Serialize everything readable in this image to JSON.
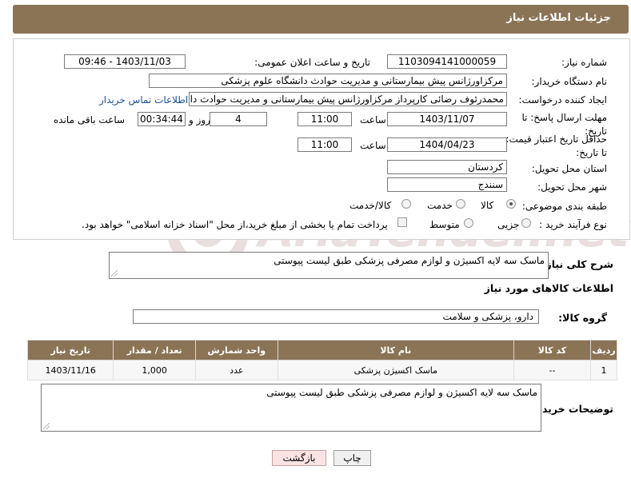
{
  "header": {
    "title": "جزئیات اطلاعات نیاز"
  },
  "form": {
    "need_number_label": "شماره نیاز:",
    "need_number": "1103094141000059",
    "announce_datetime_label": "تاریخ و ساعت اعلان عمومی:",
    "announce_datetime": "1403/11/03 - 09:46",
    "buyer_org_label": "نام دستگاه خریدار:",
    "buyer_org": "مرکزاورژانس پیش بیمارستانی و مدیریت حوادث دانشگاه علوم پزشکی",
    "requester_label": "ایجاد کننده درخواست:",
    "requester": "محمدرئوف رضائی کارپرداز مرکزاورژانس پیش بیمارستانی و مدیریت حوادث دانشگ",
    "contact_link": "اطلاعات تماس خریدار",
    "reply_deadline_label": "مهلت ارسال پاسخ: تا تاریخ:",
    "reply_date": "1403/11/07",
    "time_label": "ساعت",
    "reply_time": "11:00",
    "days_value": "4",
    "days_and_label": "روز و",
    "remaining_time": "00:34:44",
    "remaining_label": "ساعت باقی مانده",
    "price_validity_label": "حداقل تاریخ اعتبار قیمت: تا تاریخ:",
    "price_date": "1404/04/23",
    "price_time": "11:00",
    "province_label": "استان محل تحویل:",
    "province": "کردستان",
    "city_label": "شهر محل تحویل:",
    "city": "سنندج",
    "category_label": "طبقه بندی موضوعی:",
    "category_options": [
      "کالا",
      "خدمت",
      "کالا/خدمت"
    ],
    "category_selected": "کالا",
    "purchase_type_label": "نوع فرآیند خرید :",
    "purchase_options": [
      "جزیی",
      "متوسط"
    ],
    "payment_note": "پرداخت تمام یا بخشی از مبلغ خرید،از محل \"اسناد خزانه اسلامی\" خواهد بود."
  },
  "summary": {
    "label": "شرح کلی نیاز:",
    "text": "ماسک سه لایه اکسیژن و لوازم مصرفی پزشکی طبق لیست پیوستی"
  },
  "goods": {
    "section_title": "اطلاعات کالاهای مورد نیاز",
    "group_label": "گروه کالا:",
    "group_value": "دارو، پزشکی و سلامت",
    "columns": [
      "ردیف",
      "کد کالا",
      "نام کالا",
      "واحد شمارش",
      "تعداد / مقدار",
      "تاریخ نیاز"
    ],
    "rows": [
      {
        "row": "1",
        "code": "--",
        "name": "ماسک اکسیژن پزشکی",
        "unit": "عدد",
        "qty": "1,000",
        "date": "1403/11/16"
      }
    ]
  },
  "buyer_notes": {
    "label": "توضیحات خریدار:",
    "text": "ماسک سه لایه اکسیژن و لوازم مصرفی پزشکی طبق لیست پیوستی"
  },
  "buttons": {
    "print": "چاپ",
    "back": "بازگشت"
  },
  "watermark": {
    "brand": "AriaTender.net"
  },
  "colors": {
    "header_bg": "#8b7355",
    "link": "#1a4f9c",
    "back_button_bg": "#fbe3e3"
  }
}
